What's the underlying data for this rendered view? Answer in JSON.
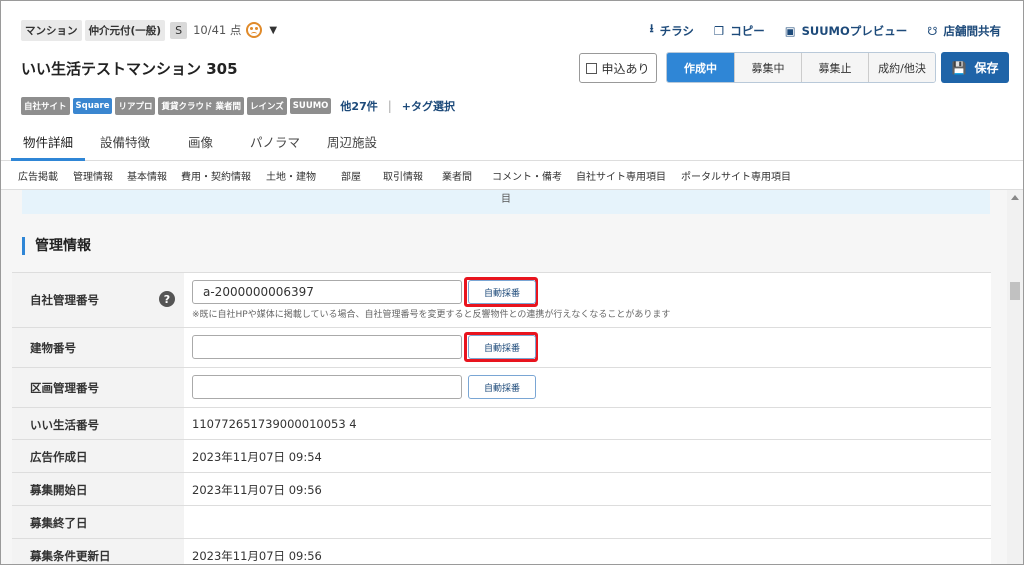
{
  "header": {
    "tags": [
      "マンション",
      "仲介元付(一般)"
    ],
    "s_badge": "S",
    "score": "10/41 点",
    "links": [
      {
        "label": "チラシ",
        "icon": "download-icon"
      },
      {
        "label": "コピー",
        "icon": "copy-icon"
      },
      {
        "label": "SUUMOプレビュー",
        "icon": "monitor-icon"
      },
      {
        "label": "店舗間共有",
        "icon": "share-icon"
      }
    ],
    "title": "いい生活テストマンション 305",
    "apply_label": "申込あり",
    "status": [
      "作成中",
      "募集中",
      "募集止",
      "成約/他決"
    ],
    "active_status": "作成中",
    "save_label": "保存"
  },
  "portal_tags": [
    "自社サイト",
    "Square",
    "リアプロ",
    "賃貸クラウド 業者間",
    "レインズ",
    "SUUMO"
  ],
  "portal_more": "他27件",
  "tag_select": "+タグ選択",
  "tabs": [
    "物件詳細",
    "設備特徴",
    "画像",
    "パノラマ",
    "周辺施設"
  ],
  "subnav": [
    "広告掲載",
    "管理情報",
    "基本情報",
    "費用・契約情報",
    "土地・建物",
    "部屋",
    "取引情報",
    "業者間",
    "コメント・備考",
    "自社サイト専用項目",
    "ポータルサイト専用項目"
  ],
  "banner_text": "目",
  "section_title": "管理情報",
  "form": {
    "company_no_label": "自社管理番号",
    "company_no_value": "a-2000000006397",
    "auto_label": "自動採番",
    "company_no_note": "※既に自社HPや媒体に掲載している場合、自社管理番号を変更すると反響物件との連携が行えなくなることがあります",
    "building_no_label": "建物番号",
    "unit_no_label": "区画管理番号",
    "ii_no_label": "いい生活番号",
    "ii_no_value": "110772651739000010053 4",
    "ad_date_label": "広告作成日",
    "ad_date_value": "2023年11月07日 09:54",
    "start_label": "募集開始日",
    "start_value": "2023年11月07日 09:56",
    "end_label": "募集終了日",
    "end_value": "",
    "update_label": "募集条件更新日",
    "update_value": "2023年11月07日 09:56"
  }
}
